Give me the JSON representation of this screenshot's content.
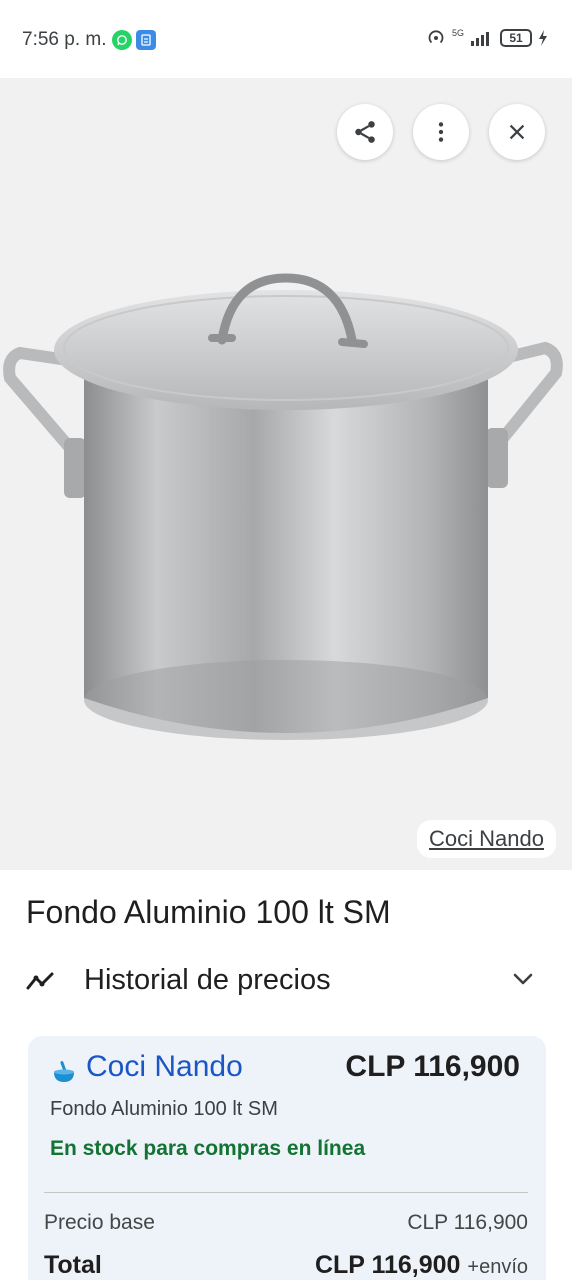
{
  "status_bar": {
    "time": "7:56 p. m.",
    "network": "5G",
    "battery": "51"
  },
  "image": {
    "merchant_chip": "Coci Nando"
  },
  "product": {
    "title": "Fondo Aluminio 100 lt SM"
  },
  "price_history": {
    "label": "Historial de precios"
  },
  "offer": {
    "merchant": "Coci Nando",
    "price": "CLP 116,900",
    "product_name": "Fondo Aluminio 100 lt SM",
    "stock": "En stock para compras en línea",
    "base_label": "Precio base",
    "base_value": "CLP 116,900",
    "total_label": "Total",
    "total_value": "CLP 116,900",
    "shipping": "+envío"
  },
  "colors": {
    "merchant_link": "#1a56c4",
    "stock_green": "#137333",
    "card_bg": "#eef2f9"
  }
}
